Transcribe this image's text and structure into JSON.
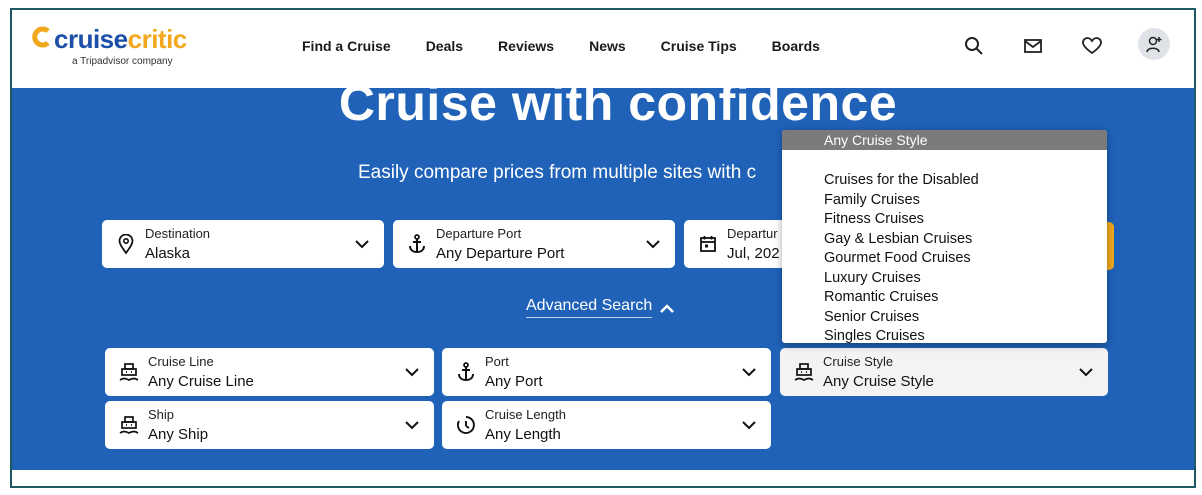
{
  "logo": {
    "cruise": "cruise",
    "critic": "critic",
    "sub": "a Tripadvisor company"
  },
  "nav": [
    "Find a Cruise",
    "Deals",
    "Reviews",
    "News",
    "Cruise Tips",
    "Boards"
  ],
  "header_icons": [
    "search-icon",
    "mail-icon",
    "heart-icon",
    "user-add-icon"
  ],
  "hero": {
    "title": "Cruise with confidence",
    "subtitle": "Easily compare prices from multiple sites with c"
  },
  "search": {
    "destination": {
      "label": "Destination",
      "value": "Alaska"
    },
    "departure_port": {
      "label": "Departure Port",
      "value": "Any Departure Port"
    },
    "departure_date": {
      "label": "Departur",
      "value": "Jul, 202"
    }
  },
  "advanced_search": "Advanced Search",
  "advanced": {
    "cruise_line": {
      "label": "Cruise Line",
      "value": "Any Cruise Line"
    },
    "port": {
      "label": "Port",
      "value": "Any Port"
    },
    "cruise_style": {
      "label": "Cruise Style",
      "value": "Any Cruise Style"
    },
    "ship": {
      "label": "Ship",
      "value": "Any Ship"
    },
    "cruise_length": {
      "label": "Cruise Length",
      "value": "Any Length"
    }
  },
  "dropdown": {
    "selected": "Any Cruise Style",
    "options": [
      "Cruises for the Disabled",
      "Family Cruises",
      "Fitness Cruises",
      "Gay & Lesbian Cruises",
      "Gourmet Food Cruises",
      "Luxury Cruises",
      "Romantic Cruises",
      "Senior Cruises",
      "Singles Cruises"
    ]
  },
  "colors": {
    "brand_blue": "#1f62b8",
    "logo_blue": "#1b4fa8",
    "accent_orange": "#f2a81d"
  }
}
